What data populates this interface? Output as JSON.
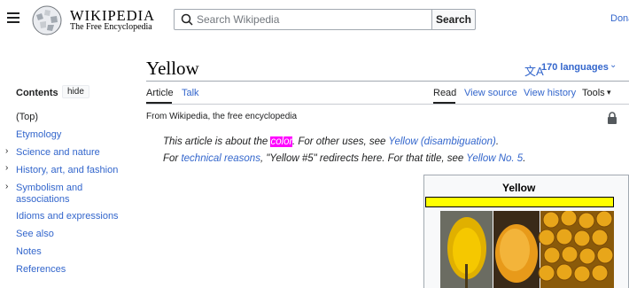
{
  "header": {
    "wordmark": "Wikipedia",
    "tagline": "The Free Encyclopedia",
    "search_placeholder": "Search Wikipedia",
    "search_button": "Search",
    "donate": "Donate"
  },
  "page": {
    "title": "Yellow",
    "languages": "170 languages",
    "tabs_left": [
      "Article",
      "Talk"
    ],
    "tabs_right": [
      "Read",
      "View source",
      "View history",
      "Tools"
    ]
  },
  "toc": {
    "heading": "Contents",
    "hide": "hide",
    "items": [
      "(Top)",
      "Etymology",
      "Science and nature",
      "History, art, and fashion",
      "Symbolism and associations",
      "Idioms and expressions",
      "See also",
      "Notes",
      "References"
    ]
  },
  "content": {
    "from": "From Wikipedia, the free encyclopedia",
    "hatnote1": {
      "a": "This article is about the ",
      "hl": "color",
      "b": ". For other uses, see ",
      "link": "Yellow (disambiguation)",
      "c": "."
    },
    "hatnote2": {
      "a": "For ",
      "link1": "technical reasons",
      "b": ", \"Yellow #5\" redirects here. For that title, see ",
      "link2": "Yellow No. 5",
      "c": "."
    }
  },
  "infobox": {
    "title": "Yellow",
    "swatch_color": "#ffff00"
  },
  "colors": {
    "link": "#3366cc",
    "highlight": "#ff00ff",
    "text": "#202122"
  }
}
